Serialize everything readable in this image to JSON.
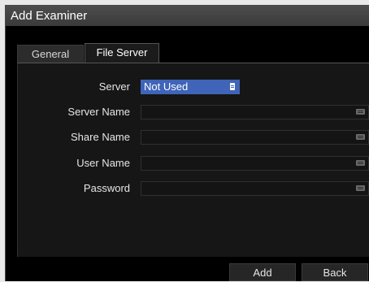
{
  "window": {
    "title": "Add Examiner"
  },
  "tabs": [
    {
      "label": "General",
      "active": false
    },
    {
      "label": "File Server",
      "active": true
    }
  ],
  "form": {
    "server": {
      "label": "Server",
      "value": "Not Used"
    },
    "server_name": {
      "label": "Server Name",
      "value": ""
    },
    "share_name": {
      "label": "Share Name",
      "value": ""
    },
    "user_name": {
      "label": "User Name",
      "value": ""
    },
    "password": {
      "label": "Password",
      "value": ""
    }
  },
  "buttons": {
    "add": "Add",
    "back": "Back"
  },
  "colors": {
    "accent": "#3f64b8",
    "background": "#000000",
    "titlebar": "#444444"
  },
  "icons": {
    "field_action": "keyboard-icon",
    "dropdown": "list-icon"
  }
}
